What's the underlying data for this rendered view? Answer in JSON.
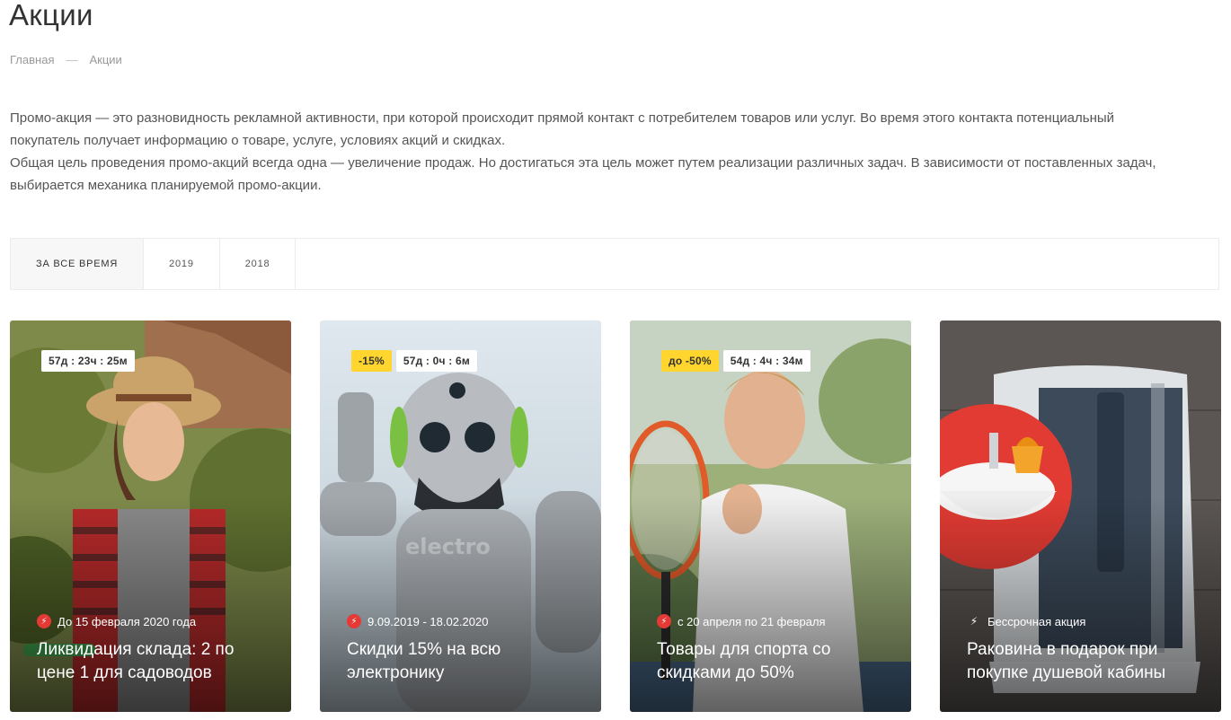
{
  "page": {
    "title": "Акции"
  },
  "breadcrumb": {
    "home": "Главная",
    "separator": "—",
    "current": "Акции"
  },
  "intro": {
    "paragraph1": "Промо-акция — это разновидность рекламной активности, при которой происходит прямой контакт с потребителем товаров или услуг. Во время этого контакта потенциальный покупатель получает информацию о товаре, услуге, условиях акций и скидках.",
    "paragraph2": "Общая цель проведения промо-акций всегда одна — увеличение продаж. Но достигаться эта цель может путем реализации различных задач. В зависимости от поставленных задач, выбирается механика планируемой промо-акции."
  },
  "filters": [
    {
      "label": "ЗА ВСЕ ВРЕМЯ",
      "active": true
    },
    {
      "label": "2019",
      "active": false
    },
    {
      "label": "2018",
      "active": false
    }
  ],
  "colors": {
    "discount_badge": "#ffd52e",
    "bolt": "#e53935"
  },
  "promos": [
    {
      "timer": "57д : 23ч : 25м",
      "discount": "",
      "date": "До 15 февраля 2020 года",
      "title": "Ликвидация склада: 2 по цене 1 для садоводов",
      "icon": "bolt-icon"
    },
    {
      "timer": "57д : 0ч : 6м",
      "discount": "-15%",
      "date": "9.09.2019 - 18.02.2020",
      "title": "Скидки 15% на всю электронику",
      "icon": "bolt-icon"
    },
    {
      "timer": "54д : 4ч : 34м",
      "discount": "до -50%",
      "date": "с 20 апреля по 21 февраля",
      "title": "Товары для спорта со скидками до 50%",
      "icon": "bolt-icon"
    },
    {
      "timer": "",
      "discount": "",
      "date": "Бессрочная акция",
      "title": "Раковина в подарок при покупке душевой кабины",
      "icon": "bolt-outline-icon"
    }
  ]
}
